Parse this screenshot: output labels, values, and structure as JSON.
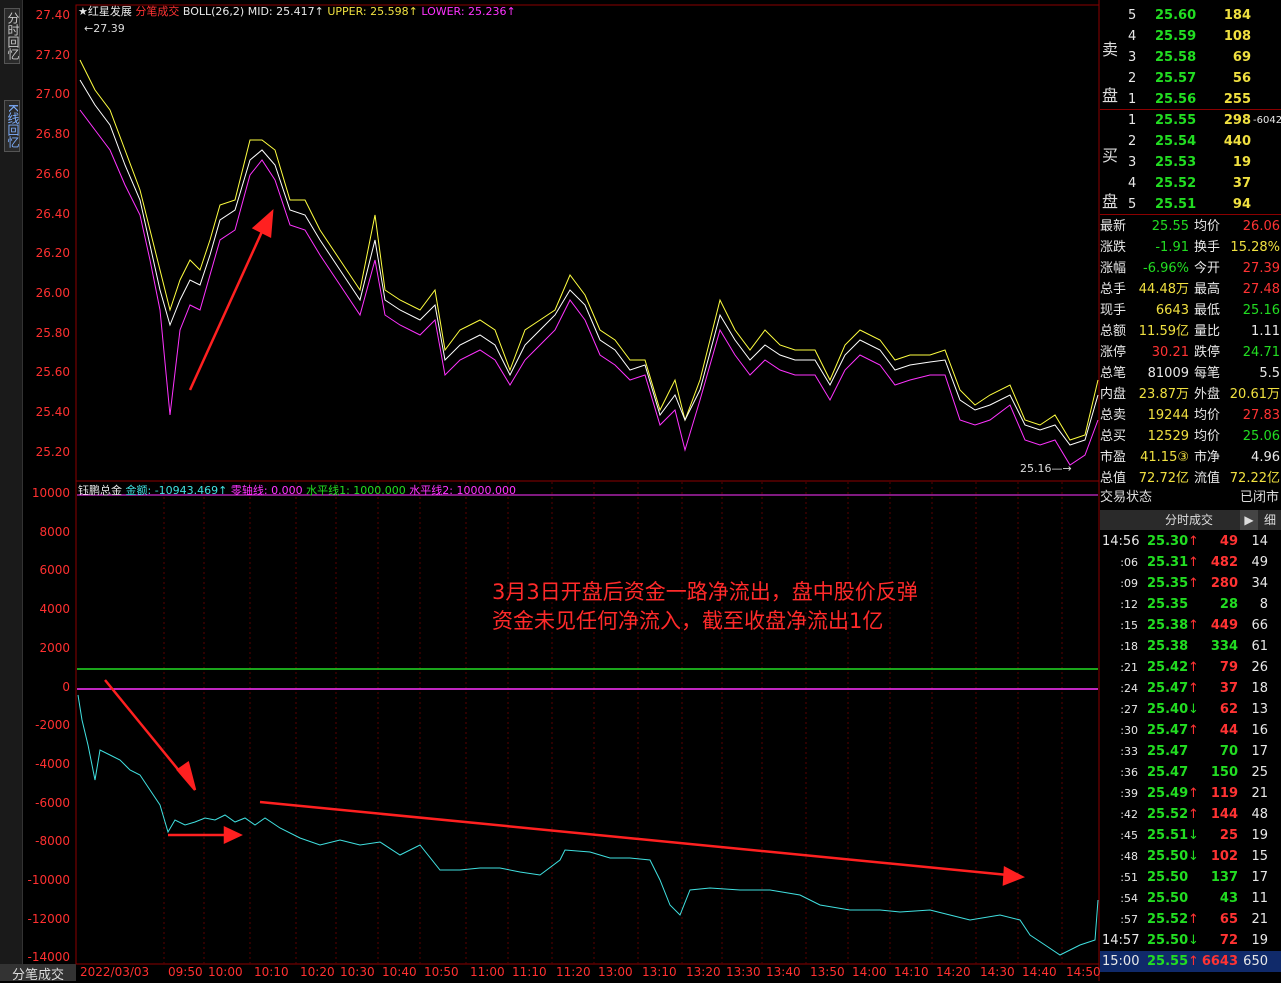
{
  "side_tabs": [
    "分时回忆",
    "K线回忆"
  ],
  "top": {
    "name": "红星发展",
    "mode": "分笔成交",
    "boll": "BOLL(26,2)",
    "mid": "MID: 25.417↑",
    "upper": "UPPER: 25.598↑",
    "lower": "LOWER: 25.236↑",
    "high_mark": "27.39",
    "low_mark": "25.16"
  },
  "price_axis": [
    "27.40",
    "27.20",
    "27.00",
    "26.80",
    "26.60",
    "26.40",
    "26.20",
    "26.00",
    "25.80",
    "25.60",
    "25.40",
    "25.20"
  ],
  "money_axis": [
    "10000",
    "8000",
    "6000",
    "4000",
    "2000",
    "0",
    "-2000",
    "-4000",
    "-6000",
    "-8000",
    "-10000",
    "-12000",
    "-14000"
  ],
  "indicator": {
    "name": "钰鹏总金",
    "amount": "金额: -10943.469↑",
    "zero": "零轴线: 0.000",
    "h1": "水平线1: 1000.000",
    "h2": "水平线2: 10000.000"
  },
  "annotation": [
    "3月3日开盘后资金一路净流出，盘中股价反弹",
    "资金未见任何净流入，截至收盘净流出1亿"
  ],
  "time_axis": [
    "2022/03/03",
    "09:50",
    "10:00",
    "10:10",
    "10:20",
    "10:30",
    "10:40",
    "10:50",
    "11:00",
    "11:10",
    "11:20",
    "13:00",
    "13:10",
    "13:20",
    "13:30",
    "13:40",
    "13:50",
    "14:00",
    "14:10",
    "14:20",
    "14:30",
    "14:40",
    "14:50"
  ],
  "bottom_tab": "分笔成交",
  "sell_label": [
    "卖",
    "盘"
  ],
  "buy_label": [
    "买",
    "盘"
  ],
  "sell": [
    [
      "5",
      "25.60",
      "184"
    ],
    [
      "4",
      "25.59",
      "108"
    ],
    [
      "3",
      "25.58",
      "69"
    ],
    [
      "2",
      "25.57",
      "56"
    ],
    [
      "1",
      "25.56",
      "255"
    ]
  ],
  "buy": [
    [
      "1",
      "25.55",
      "298",
      "-6042"
    ],
    [
      "2",
      "25.54",
      "440",
      ""
    ],
    [
      "3",
      "25.53",
      "19",
      ""
    ],
    [
      "4",
      "25.52",
      "37",
      ""
    ],
    [
      "5",
      "25.51",
      "94",
      ""
    ]
  ],
  "stats": [
    [
      "最新",
      "25.55",
      "均价",
      "26.06"
    ],
    [
      "涨跌",
      "-1.91",
      "换手",
      "15.28%"
    ],
    [
      "涨幅",
      "-6.96%",
      "今开",
      "27.39"
    ],
    [
      "总手",
      "44.48万",
      "最高",
      "27.48"
    ],
    [
      "现手",
      "6643",
      "最低",
      "25.16"
    ],
    [
      "总额",
      "11.59亿",
      "量比",
      "1.11"
    ],
    [
      "涨停",
      "30.21",
      "跌停",
      "24.71"
    ],
    [
      "总笔",
      "81009",
      "每笔",
      "5.5"
    ],
    [
      "内盘",
      "23.87万",
      "外盘",
      "20.61万"
    ],
    [
      "总卖",
      "19244",
      "均价",
      "27.83"
    ],
    [
      "总买",
      "12529",
      "均价",
      "25.06"
    ],
    [
      "市盈",
      "41.15③",
      "市净",
      "4.96"
    ],
    [
      "总值",
      "72.72亿",
      "流值",
      "72.22亿"
    ]
  ],
  "trade_status": [
    "交易状态",
    "已闭市"
  ],
  "ticks_header": {
    "title": "分时成交",
    "btn1": "▶",
    "btn2": "细"
  },
  "ticks": [
    [
      "14:56",
      "25.30",
      "↑",
      "49",
      "14"
    ],
    [
      ":06",
      "25.31",
      "↑",
      "482",
      "49"
    ],
    [
      ":09",
      "25.35",
      "↑",
      "280",
      "34"
    ],
    [
      ":12",
      "25.35",
      "",
      "28",
      "8"
    ],
    [
      ":15",
      "25.38",
      "↑",
      "449",
      "66"
    ],
    [
      ":18",
      "25.38",
      "",
      "334",
      "61"
    ],
    [
      ":21",
      "25.42",
      "↑",
      "79",
      "26"
    ],
    [
      ":24",
      "25.47",
      "↑",
      "37",
      "18"
    ],
    [
      ":27",
      "25.40",
      "↓",
      "62",
      "13"
    ],
    [
      ":30",
      "25.47",
      "↑",
      "44",
      "16"
    ],
    [
      ":33",
      "25.47",
      "",
      "70",
      "17"
    ],
    [
      ":36",
      "25.47",
      "",
      "150",
      "25"
    ],
    [
      ":39",
      "25.49",
      "↑",
      "119",
      "21"
    ],
    [
      ":42",
      "25.52",
      "↑",
      "144",
      "48"
    ],
    [
      ":45",
      "25.51",
      "↓",
      "25",
      "19"
    ],
    [
      ":48",
      "25.50",
      "↓",
      "102",
      "15"
    ],
    [
      ":51",
      "25.50",
      "",
      "137",
      "17"
    ],
    [
      ":54",
      "25.50",
      "",
      "43",
      "11"
    ],
    [
      ":57",
      "25.52",
      "↑",
      "65",
      "21"
    ],
    [
      "14:57",
      "25.50",
      "↓",
      "72",
      "19"
    ],
    [
      "15:00",
      "25.55",
      "↑",
      "6643",
      "650"
    ]
  ],
  "colors": {
    "up": "#ff3333",
    "down": "#22dd22",
    "money": "#40e0e0",
    "upper": "#ffff40",
    "lower": "#ff33ff",
    "grid": "#8b0000"
  }
}
